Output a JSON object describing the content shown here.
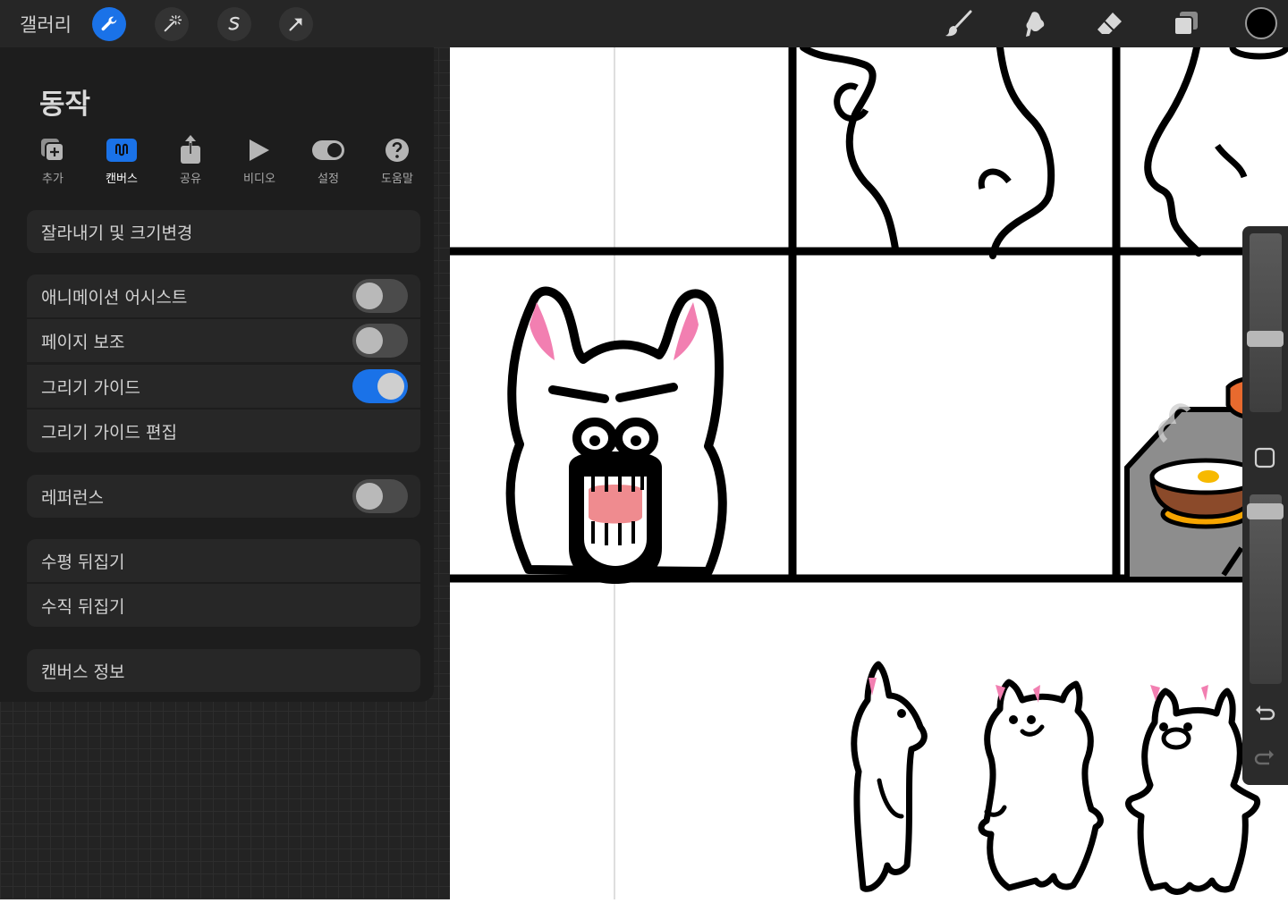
{
  "topbar": {
    "gallery_label": "갤러리",
    "tools_left": [
      "wrench-icon",
      "magic-wand-icon",
      "selection-icon",
      "transform-arrow-icon"
    ],
    "tools_right": [
      "brush-icon",
      "smudge-icon",
      "eraser-icon",
      "layers-icon"
    ],
    "color": "#000000",
    "accent": "#1a72e8"
  },
  "panel": {
    "title": "동작",
    "tabs": [
      {
        "label": "추가",
        "icon": "add-image-icon"
      },
      {
        "label": "캔버스",
        "icon": "canvas-icon",
        "active": true
      },
      {
        "label": "공유",
        "icon": "share-icon"
      },
      {
        "label": "비디오",
        "icon": "play-icon"
      },
      {
        "label": "설정",
        "icon": "toggle-icon"
      },
      {
        "label": "도움말",
        "icon": "help-icon"
      }
    ],
    "crop_resize": "잘라내기 및 크기변경",
    "animation_assist": {
      "label": "애니메이션 어시스트",
      "on": false
    },
    "page_assist": {
      "label": "페이지 보조",
      "on": false
    },
    "drawing_guide": {
      "label": "그리기 가이드",
      "on": true
    },
    "edit_drawing_guide": "그리기 가이드 편집",
    "reference": {
      "label": "레퍼런스",
      "on": false
    },
    "flip_horizontal": "수평 뒤집기",
    "flip_vertical": "수직 뒤집기",
    "canvas_info": "캔버스 정보"
  },
  "sidebar": {
    "icons": [
      "modify-square-icon",
      "undo-icon",
      "redo-icon"
    ]
  }
}
